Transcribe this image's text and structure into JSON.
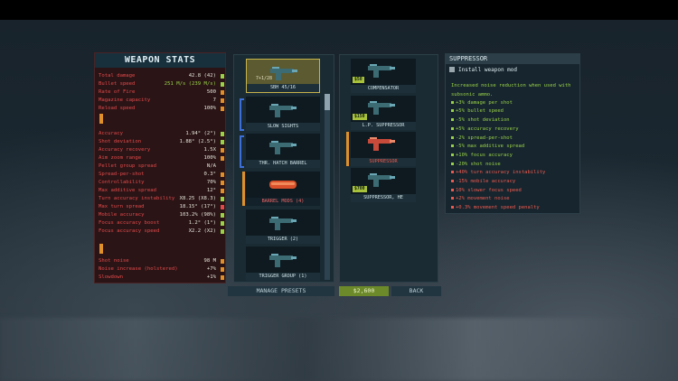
{
  "stats": {
    "title": "WEAPON STATS",
    "rows": [
      {
        "label": "Total damage",
        "value": "42.8 (42)",
        "mark": "#9ad248",
        "valcls": ""
      },
      {
        "label": "Bullet speed",
        "value": "251 M/s (239 M/s)",
        "mark": "#9ad248",
        "valcls": "green"
      },
      {
        "label": "Rate of Fire",
        "value": "500",
        "mark": "#e0902a",
        "valcls": ""
      },
      {
        "label": "Magazine capacity",
        "value": "7",
        "mark": "#e0902a",
        "valcls": ""
      },
      {
        "label": "Reload speed",
        "value": "100%",
        "mark": "#e0902a",
        "valcls": ""
      },
      {
        "label": "Accuracy",
        "value": "1.94° (2°)",
        "mark": "#9ad248",
        "valcls": ""
      },
      {
        "label": "Shot deviation",
        "value": "1.88° (2.5°)",
        "mark": "#9ad248",
        "valcls": ""
      },
      {
        "label": "Accuracy recovery",
        "value": "1.5X",
        "mark": "#e0902a",
        "valcls": ""
      },
      {
        "label": "Aim zoom range",
        "value": "100%",
        "mark": "#e0902a",
        "valcls": ""
      },
      {
        "label": "Pellet group spread",
        "value": "N/A",
        "mark": "",
        "valcls": ""
      },
      {
        "label": "Spread-per-shot",
        "value": "0.3°",
        "mark": "#e0902a",
        "valcls": ""
      },
      {
        "label": "Controllability",
        "value": "70%",
        "mark": "#e0902a",
        "valcls": ""
      },
      {
        "label": "Max additive spread",
        "value": "12°",
        "mark": "#e0902a",
        "valcls": ""
      },
      {
        "label": "Turn accuracy instability",
        "value": "X8.25 (X8.3)",
        "mark": "#9ad248",
        "valcls": ""
      },
      {
        "label": "Max turn spread",
        "value": "18.15° (17°)",
        "mark": "#e44a4a",
        "valcls": ""
      },
      {
        "label": "Mobile accuracy",
        "value": "103.2% (98%)",
        "mark": "#9ad248",
        "valcls": ""
      },
      {
        "label": "Focus accuracy boost",
        "value": "1.2° (1°)",
        "mark": "#9ad248",
        "valcls": ""
      },
      {
        "label": "Focus accuracy speed",
        "value": "X2.2 (X2)",
        "mark": "#9ad248",
        "valcls": ""
      },
      {
        "label": "Shot noise",
        "value": "98 M",
        "mark": "#e0902a",
        "valcls": ""
      },
      {
        "label": "Noise increase (holstered)",
        "value": "+7%",
        "mark": "#e0902a",
        "valcls": ""
      },
      {
        "label": "Slowdown",
        "value": "+1%",
        "mark": "#e0902a",
        "valcls": ""
      }
    ]
  },
  "slots": [
    {
      "name": "SBH 45/16",
      "ammo": "7+1/28",
      "style": "gold"
    },
    {
      "name": "SLOW SIGHTS",
      "style": "bracket"
    },
    {
      "name": "THR. HATCH BARREL",
      "style": "bracket"
    },
    {
      "name": "BARREL MODS (4)",
      "style": "selected"
    },
    {
      "name": "TRIGGER (2)",
      "style": "plain"
    },
    {
      "name": "TRIGGER GROUP (1)",
      "style": "plain"
    }
  ],
  "options": [
    {
      "name": "COMPENSATOR",
      "price": "$50",
      "red": false
    },
    {
      "name": "L.P. SUPPRESSOR",
      "price": "$150",
      "red": false
    },
    {
      "name": "SUPPRESSOR",
      "price": "",
      "red": true
    },
    {
      "name": "SUPPRESSOR, HE",
      "price": "$700",
      "red": false
    }
  ],
  "desc": {
    "title": "SUPPRESSOR",
    "install": "Install weapon mod",
    "lines": [
      {
        "t": "Increased noise reduction when used with",
        "c": "green",
        "dot": false
      },
      {
        "t": "subsonic ammo.",
        "c": "green",
        "dot": false
      },
      {
        "t": "+3% damage per shot",
        "c": "green",
        "dot": true
      },
      {
        "t": "+5% bullet speed",
        "c": "green",
        "dot": true
      },
      {
        "t": "-5% shot deviation",
        "c": "green",
        "dot": true
      },
      {
        "t": "+5% accuracy recovery",
        "c": "green",
        "dot": true
      },
      {
        "t": "-2% spread-per-shot",
        "c": "green",
        "dot": true
      },
      {
        "t": "-5% max additive spread",
        "c": "green",
        "dot": true
      },
      {
        "t": "+10% focus accuracy",
        "c": "green",
        "dot": true
      },
      {
        "t": "-20% shot noise",
        "c": "green",
        "dot": true
      },
      {
        "t": "+40% turn accuracy instability",
        "c": "red",
        "dot": true
      },
      {
        "t": "-15% mobile accuracy",
        "c": "red",
        "dot": true
      },
      {
        "t": "10% slower focus speed",
        "c": "red",
        "dot": true
      },
      {
        "t": "+2% movement noise",
        "c": "red",
        "dot": true
      },
      {
        "t": "+0.3% movement speed penalty",
        "c": "red",
        "dot": true
      }
    ]
  },
  "buttons": {
    "presets": "MANAGE PRESETS",
    "money": "$2,600",
    "back": "BACK"
  }
}
